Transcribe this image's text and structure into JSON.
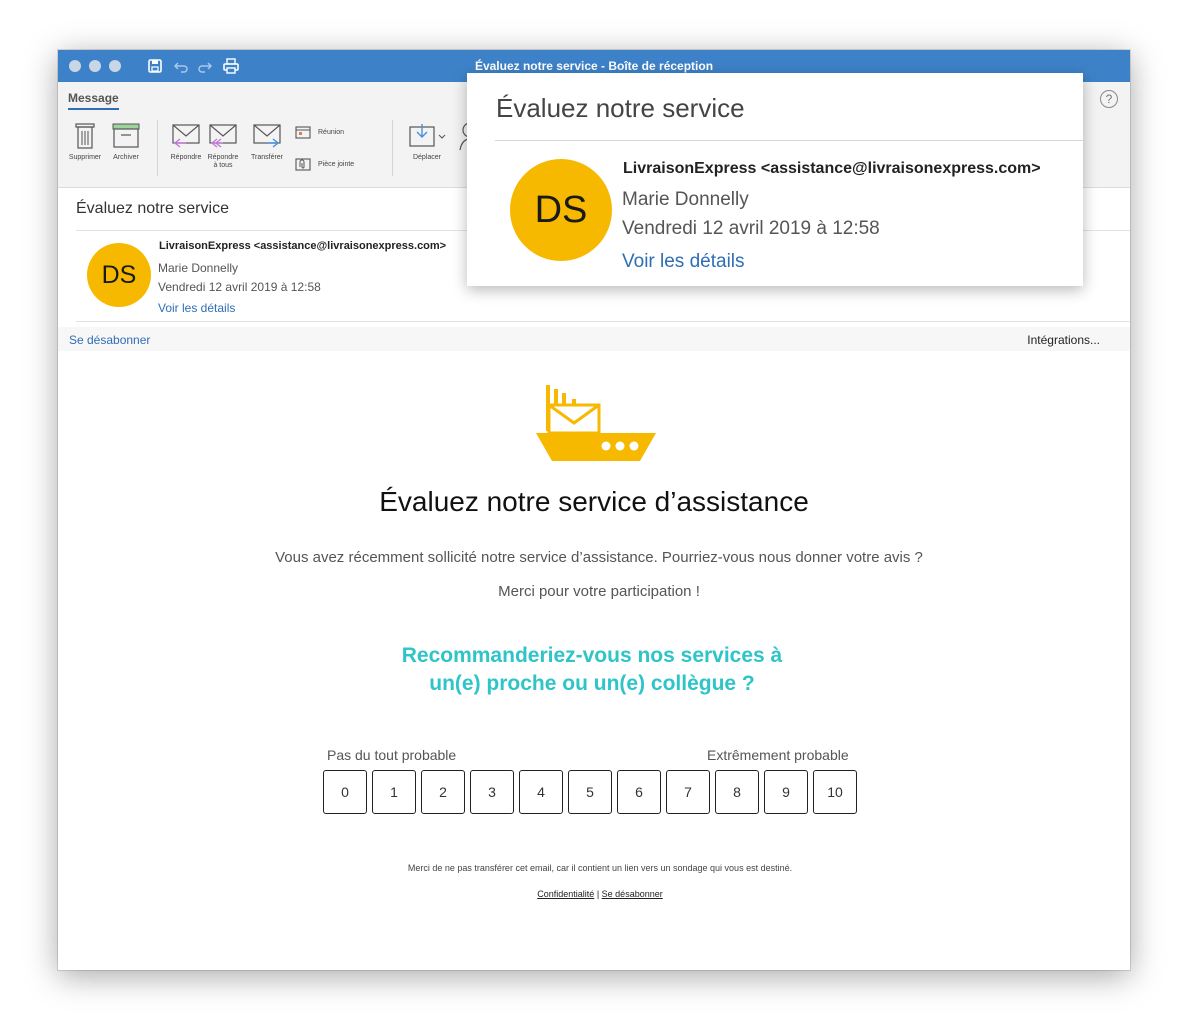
{
  "window": {
    "title": "Évaluez notre service - Boîte de réception"
  },
  "ribbon": {
    "tab_label": "Message",
    "help_label": "?",
    "delete_label": "Supprimer",
    "archive_label": "Archiver",
    "reply_label": "Répondre",
    "reply_all_label_line1": "Répondre",
    "reply_all_label_line2": "à tous",
    "forward_label": "Transférer",
    "meeting_label": "Réunion",
    "attachment_label": "Pièce jointe",
    "move_label": "Déplacer"
  },
  "message": {
    "subject": "Évaluez notre service",
    "avatar_initials": "DS",
    "from": "LivraisonExpress <assistance@livraisonexpress.com>",
    "to": "Marie Donnelly",
    "date": "Vendredi 12 avril 2019 à 12:58",
    "details_link": "Voir les détails"
  },
  "infobar": {
    "unsubscribe": "Se désabonner",
    "integrations": "Intégrations..."
  },
  "email_body": {
    "heading": "Évaluez notre service d’assistance",
    "intro": "Vous avez récemment sollicité notre service d’assistance. Pourriez-vous nous donner votre avis ?",
    "thanks": "Merci pour votre participation !",
    "question_line1": "Recommanderiez-vous nos services à",
    "question_line2": "un(e) proche ou un(e) collègue ?",
    "low_label": "Pas du tout probable",
    "high_label": "Extrêmement probable",
    "scores": [
      "0",
      "1",
      "2",
      "3",
      "4",
      "5",
      "6",
      "7",
      "8",
      "9",
      "10"
    ],
    "footer_note": "Merci de ne pas transférer cet email, car il contient un lien vers un sondage qui vous est destiné.",
    "privacy_link": "Confidentialité",
    "separator": "|",
    "unsubscribe_link": "Se désabonner"
  },
  "colors": {
    "titlebar": "#3d82c8",
    "link": "#2f6db5",
    "avatar": "#f7b900",
    "question": "#2ec4c8",
    "logo": "#f7b900"
  }
}
